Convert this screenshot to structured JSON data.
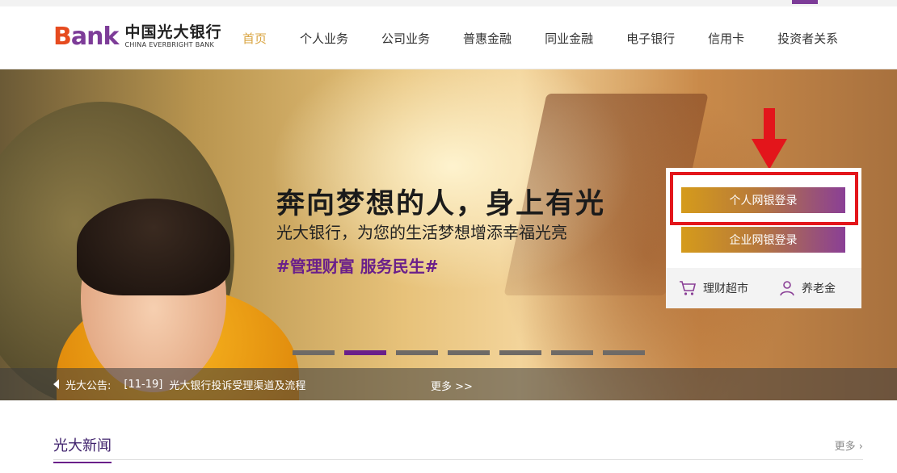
{
  "logo": {
    "bank_b": "B",
    "bank_rest": "ank",
    "name_cn": "中国光大银行",
    "name_en": "CHINA EVERBRIGHT BANK"
  },
  "nav": {
    "items": [
      "首页",
      "个人业务",
      "公司业务",
      "普惠金融",
      "同业金融",
      "电子银行",
      "信用卡",
      "投资者关系"
    ],
    "active_index": 0
  },
  "banner": {
    "slogan_main": "奔向梦想的人，身上有光",
    "slogan_sub": "光大银行，为您的生活梦想增添幸福光亮",
    "slogan_tag": "#管理财富 服务民生#",
    "carousel_count": 7,
    "carousel_active": 1
  },
  "login_panel": {
    "personal_login": "个人网银登录",
    "enterprise_login": "企业网银登录",
    "link_wealth": "理财超市",
    "link_pension": "养老金"
  },
  "notice": {
    "label": "光大公告:",
    "date": "[11-19]",
    "text": "光大银行投诉受理渠道及流程",
    "more": "更多 >>"
  },
  "news": {
    "title": "光大新闻",
    "more": "更多"
  },
  "colors": {
    "brand_purple": "#6a1f8a",
    "accent_gold": "#d59b1b",
    "highlight_red": "#e3151b",
    "nav_active": "#d9a441"
  }
}
